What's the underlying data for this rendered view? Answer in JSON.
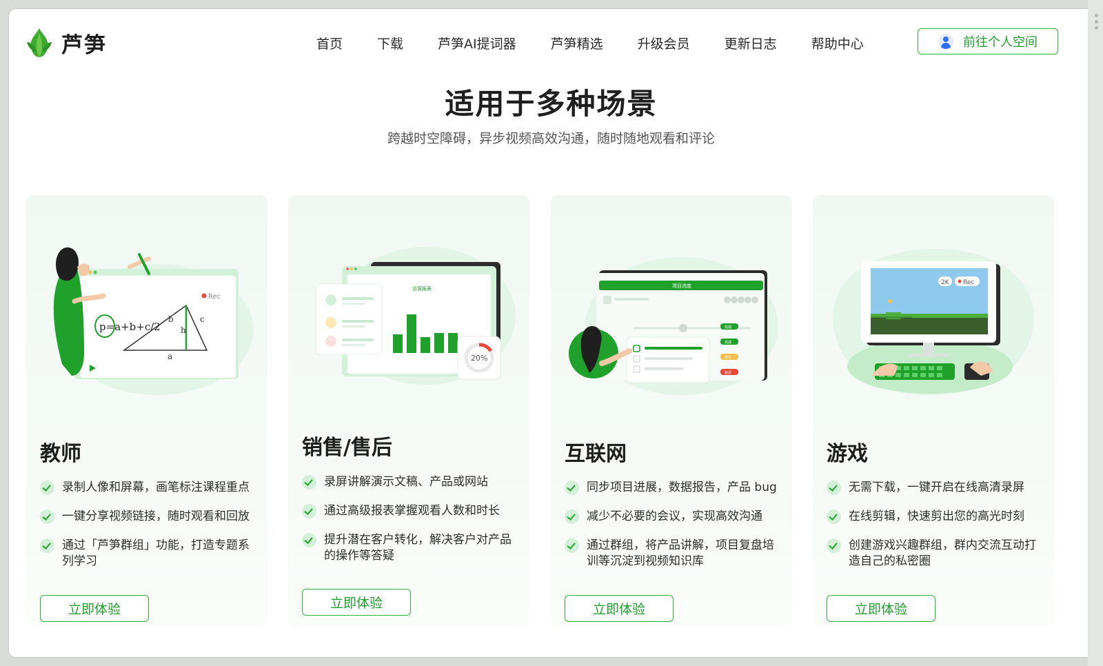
{
  "brand": {
    "name": "芦笋"
  },
  "nav": [
    "首页",
    "下载",
    "芦笋AI提词器",
    "芦笋精选",
    "升级会员",
    "更新日志",
    "帮助中心"
  ],
  "header": {
    "space_button": "前往个人空间"
  },
  "section": {
    "title": "适用于多种场景",
    "subtitle": "跨越时空障碍，异步视频高效沟通，随时随地观看和评论"
  },
  "cards": [
    {
      "title": "教师",
      "features": [
        "录制人像和屏幕，画笔标注课程重点",
        "一键分享视频链接，随时观看和回放",
        "通过「芦笋群组」功能，打造专题系列学习"
      ],
      "button": "立即体验",
      "illus_text": {
        "rec": "Rec",
        "formula": "p=a+b+c/2"
      }
    },
    {
      "title": "销售/售后",
      "features": [
        "录屏讲解演示文稿、产品或网站",
        "通过高级报表掌握观看人数和时长",
        "提升潜在客户转化，解决客户对产品的操作等答疑"
      ],
      "button": "立即体验",
      "illus_text": {
        "report": "访客报表",
        "percent": "20%"
      }
    },
    {
      "title": "互联网",
      "features": [
        "同步项目进展，数据报告，产品 bug",
        "减少不必要的会议，实现高效沟通",
        "通过群组，将产品讲解，项目复盘培训等沉淀到视频知识库"
      ],
      "button": "立即体验",
      "illus_text": {
        "progress": "项目进度",
        "tags": [
          "完成",
          "完成",
          "进行",
          "延迟"
        ]
      }
    },
    {
      "title": "游戏",
      "features": [
        "无需下载，一键开启在线高清录屏",
        "在线剪辑，快速剪出您的高光时刻",
        "创建游戏兴趣群组，群内交流互动打造自己的私密圈"
      ],
      "button": "立即体验",
      "illus_text": {
        "res": "2K",
        "rec": "Rec"
      }
    }
  ],
  "colors": {
    "accent": "#21a62f",
    "card_bg": "#f2f8f4"
  }
}
